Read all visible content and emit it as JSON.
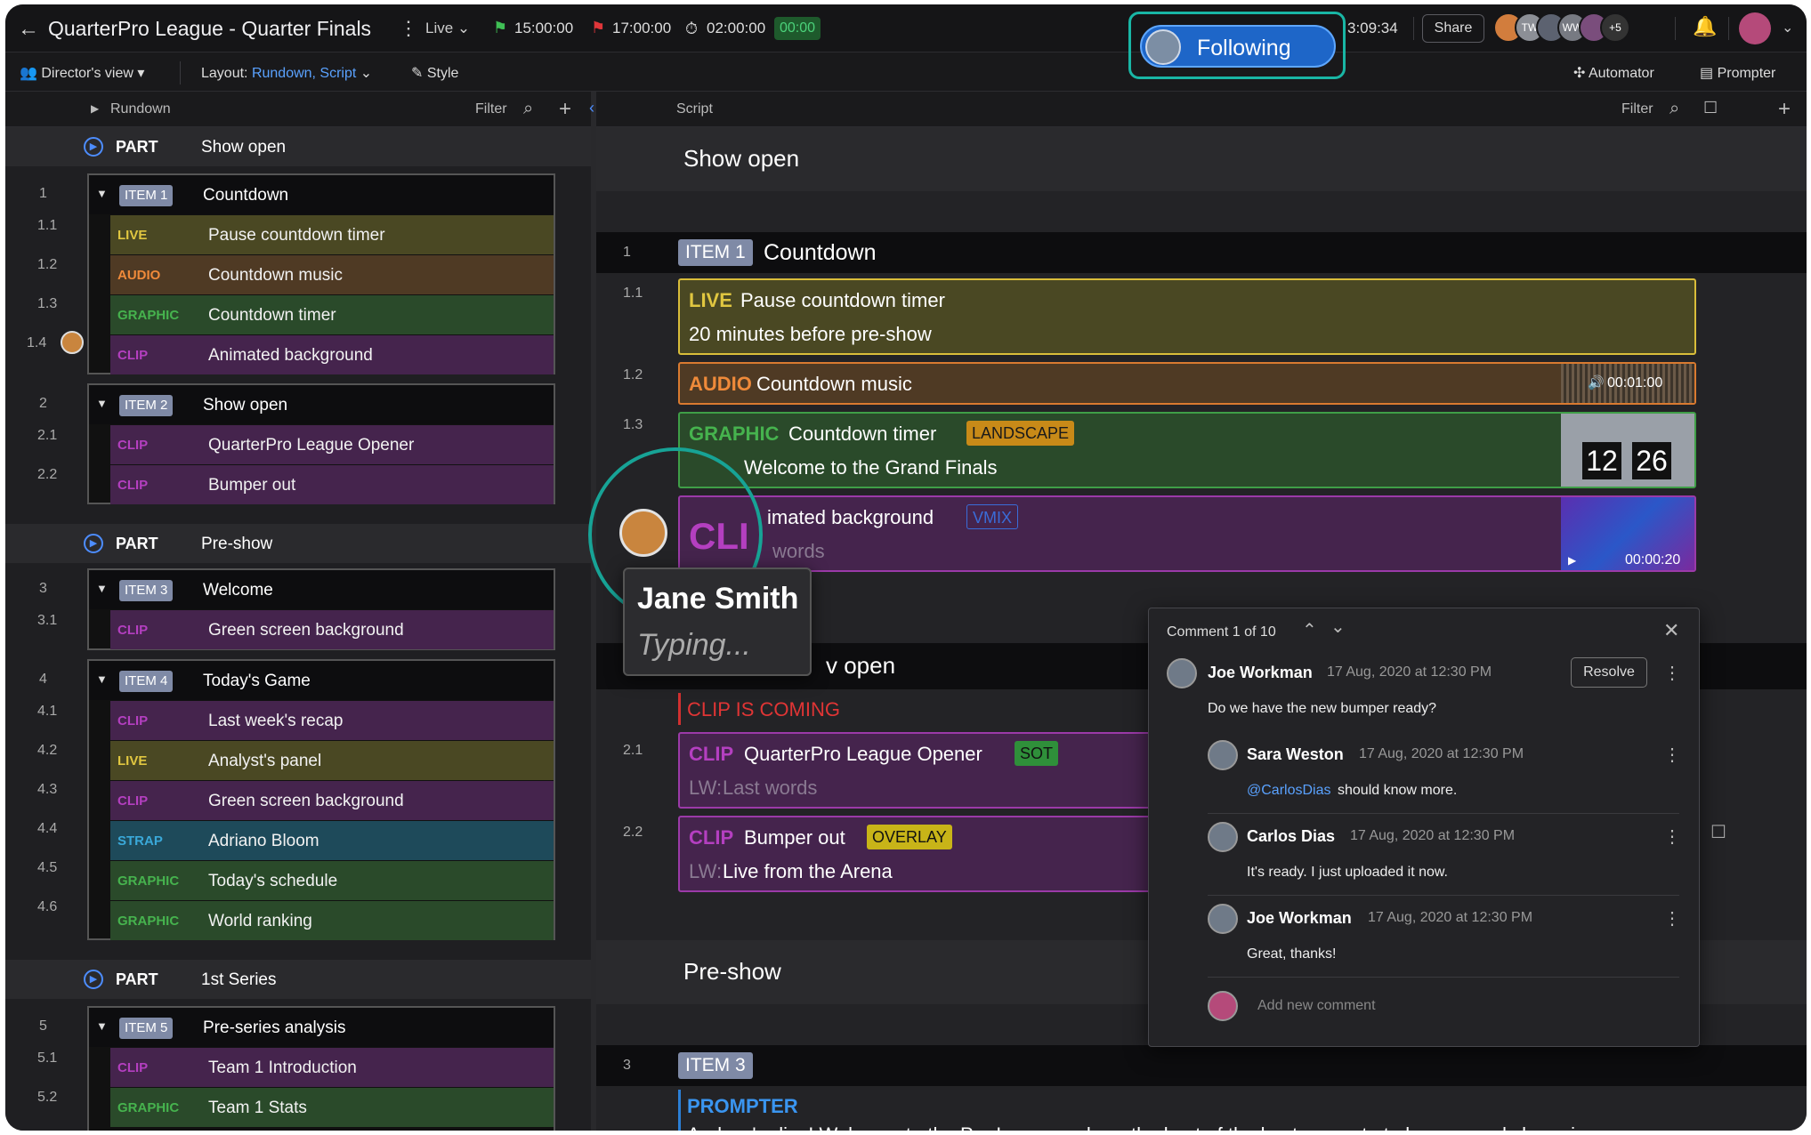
{
  "topbar": {
    "title": "QuarterPro League - Quarter Finals",
    "status": "Live",
    "start_time": "15:00:00",
    "end_time": "17:00:00",
    "duration": "02:00:00",
    "elapsed": "00:00",
    "live_timer": "3:09:34",
    "share_label": "Share",
    "avatars": [
      "",
      "TW",
      "",
      "WW",
      ""
    ],
    "more_count": "+5"
  },
  "following": {
    "label": "Following"
  },
  "toolbar": {
    "view": "Director's view",
    "layout_prefix": "Layout:",
    "layout_value": "Rundown, Script",
    "style": "Style",
    "automator": "Automator",
    "prompter": "Prompter"
  },
  "rundown": {
    "header": "Rundown",
    "filter": "Filter",
    "sections": [
      {
        "label": "PART",
        "name": "Show open"
      },
      {
        "label": "PART",
        "name": "Pre-show"
      },
      {
        "label": "PART",
        "name": "1st Series"
      }
    ],
    "items": [
      {
        "num": "1",
        "badge": "ITEM 1",
        "name": "Countdown",
        "subs": [
          {
            "num": "1.1",
            "type": "LIVE",
            "name": "Pause countdown timer"
          },
          {
            "num": "1.2",
            "type": "AUDIO",
            "name": "Countdown music"
          },
          {
            "num": "1.3",
            "type": "GRAPHIC",
            "name": "Countdown timer"
          },
          {
            "num": "1.4",
            "type": "CLIP",
            "name": "Animated background"
          }
        ]
      },
      {
        "num": "2",
        "badge": "ITEM 2",
        "name": "Show open",
        "subs": [
          {
            "num": "2.1",
            "type": "CLIP",
            "name": "QuarterPro League Opener"
          },
          {
            "num": "2.2",
            "type": "CLIP",
            "name": "Bumper out"
          }
        ]
      },
      {
        "num": "3",
        "badge": "ITEM 3",
        "name": "Welcome",
        "subs": [
          {
            "num": "3.1",
            "type": "CLIP",
            "name": "Green screen background"
          }
        ]
      },
      {
        "num": "4",
        "badge": "ITEM 4",
        "name": "Today's Game",
        "subs": [
          {
            "num": "4.1",
            "type": "CLIP",
            "name": "Last week's recap"
          },
          {
            "num": "4.2",
            "type": "LIVE",
            "name": "Analyst's panel"
          },
          {
            "num": "4.3",
            "type": "CLIP",
            "name": "Green screen background"
          },
          {
            "num": "4.4",
            "type": "STRAP",
            "name": "Adriano Bloom"
          },
          {
            "num": "4.5",
            "type": "GRAPHIC",
            "name": "Today's schedule"
          },
          {
            "num": "4.6",
            "type": "GRAPHIC",
            "name": "World ranking"
          }
        ]
      },
      {
        "num": "5",
        "badge": "ITEM 5",
        "name": "Pre-series analysis",
        "subs": [
          {
            "num": "5.1",
            "type": "CLIP",
            "name": "Team 1 Introduction"
          },
          {
            "num": "5.2",
            "type": "GRAPHIC",
            "name": "Team 1 Stats"
          }
        ]
      }
    ]
  },
  "script": {
    "header": "Script",
    "filter": "Filter",
    "section1": "Show open",
    "item1_num": "1",
    "item1_badge": "ITEM 1",
    "item1_name": "Countdown",
    "c11": {
      "num": "1.1",
      "type": "LIVE",
      "name": "Pause countdown timer",
      "sub": "20 minutes before pre-show"
    },
    "c12": {
      "num": "1.2",
      "type": "AUDIO",
      "name": "Countdown music",
      "duration": "00:01:00"
    },
    "c13": {
      "num": "1.3",
      "type": "GRAPHIC",
      "name": "Countdown timer",
      "tag": "LANDSCAPE",
      "sub": "Welcome to the Grand Finals",
      "thumb_a": "12",
      "thumb_b": "26"
    },
    "c14": {
      "type": "CLI",
      "name": "imated background",
      "tag": "VMIX",
      "sub": "words",
      "duration": "00:00:20"
    },
    "section2_partial": "v open",
    "clip_coming": "CLIP IS COMING",
    "c21": {
      "num": "2.1",
      "type": "CLIP",
      "name": "QuarterPro League Opener",
      "tag": "SOT",
      "prefix": "LW:",
      "sub": "Last words"
    },
    "c22": {
      "num": "2.2",
      "type": "CLIP",
      "name": "Bumper out",
      "tag": "OVERLAY",
      "prefix": "LW:",
      "sub": "Live from the Arena"
    },
    "section3": "Pre-show",
    "item3_num": "3",
    "item3_badge": "ITEM 3",
    "prompter": "PROMPTER",
    "prompter_text": "And we're live! Welcome to the Pro League, where the best of the best compete to be crowned champion"
  },
  "presence": {
    "name": "Jane Smith",
    "status": "Typing..."
  },
  "comments": {
    "header": "Comment 1 of 10",
    "resolve": "Resolve",
    "add_placeholder": "Add new comment",
    "thread": [
      {
        "author": "Joe Workman",
        "date": "17 Aug, 2020 at 12:30 PM",
        "text": "Do we have the new bumper ready?"
      },
      {
        "author": "Sara Weston",
        "date": "17 Aug, 2020 at 12:30 PM",
        "mention": "@CarlosDias",
        "text": "should know more."
      },
      {
        "author": "Carlos Dias",
        "date": "17 Aug, 2020 at 12:30 PM",
        "text": "It's ready. I just uploaded it now."
      },
      {
        "author": "Joe Workman",
        "date": "17 Aug, 2020 at 12:30 PM",
        "text": "Great, thanks!"
      }
    ]
  },
  "colors": {
    "live": "#e0c640",
    "audio": "#ef8a3a",
    "graphic": "#46b34e",
    "clip": "#b43fc0",
    "strap": "#3aa8d8",
    "accent": "#1e66c8",
    "follow_ring": "#19b6a5"
  }
}
